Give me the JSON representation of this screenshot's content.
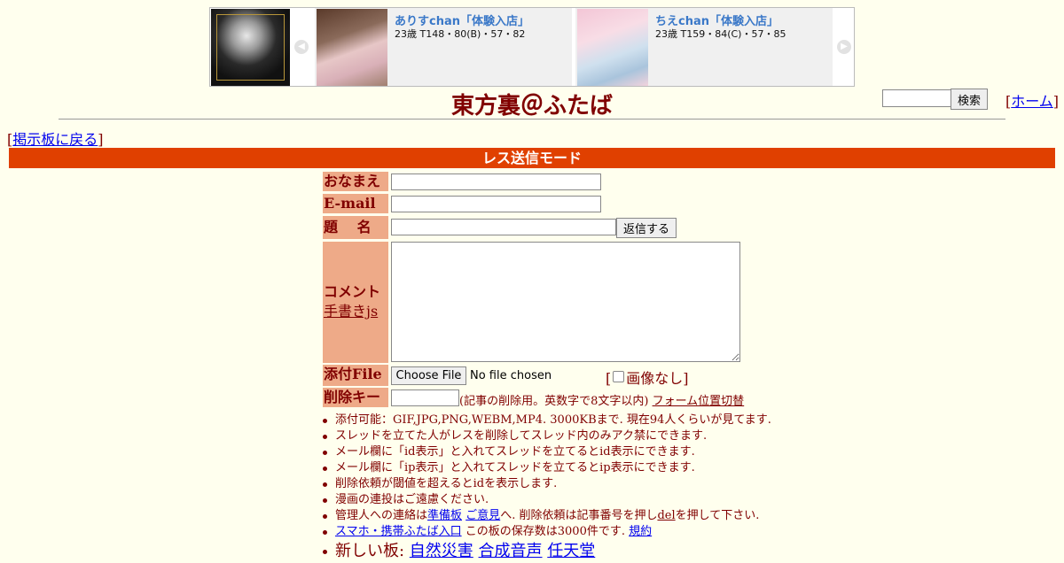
{
  "ad_banner": {
    "prev_arrow": "◀",
    "next_arrow": "▶",
    "cards": [
      {
        "name": "ありすchan「体験入店」",
        "detail": "23歳 T148・80(B)・57・82"
      },
      {
        "name": "ちえchan「体験入店」",
        "detail": "23歳 T159・84(C)・57・85"
      }
    ]
  },
  "header": {
    "site_title": "東方裏＠ふたば",
    "search_button": "検索",
    "search_value": "",
    "home_open": "[",
    "home_link": "ホーム",
    "home_close": "]"
  },
  "nav": {
    "back_open": "[",
    "back_link": "掲示板に戻る",
    "back_close": "]"
  },
  "mode_bar": {
    "label": "レス送信モード"
  },
  "form": {
    "name_label": "おなまえ",
    "email_label": "E-mail",
    "subject_label": "題　 名",
    "reply_button": "返信する",
    "comment_label": "コメント",
    "drawing_link": "手書きjs",
    "file_label": "添付File",
    "file_button": "Choose File",
    "file_status": "No file chosen",
    "no_image_open": "[",
    "no_image_label": "画像なし]",
    "delete_key_label": "削除キー",
    "delete_key_note": "(記事の削除用。英数字で8文字以内)",
    "form_position_link": "フォーム位置切替"
  },
  "notes": {
    "line1": "添付可能：GIF,JPG,PNG,WEBM,MP4. 3000KBまで. 現在94人くらいが見てます.",
    "line2": "スレッドを立てた人がレスを削除してスレッド内のみアク禁にできます.",
    "line3": "メール欄に「id表示」と入れてスレッドを立てるとid表示にできます.",
    "line4": "メール欄に「ip表示」と入れてスレッドを立てるとip表示にできます.",
    "line5": "削除依頼が閾値を超えるとidを表示します.",
    "line6": "漫画の連投はご遠慮ください.",
    "line7_prefix": "管理人への連絡は",
    "line7_link1": "準備板",
    "line7_link2": "ご意見",
    "line7_mid": "へ. 削除依頼は記事番号を押し",
    "line7_del": "del",
    "line7_suffix": "を押して下さい.",
    "line8_link": "スマホ・携帯ふたば入口",
    "line8_text": " この板の保存数は3000件です.",
    "line8_rules": "規約",
    "line9_prefix": "新しい板: ",
    "line9_link1": "自然災害",
    "line9_link2": "合成音声",
    "line9_link3": "任天堂"
  },
  "colors": {
    "background": "#ffffee",
    "text": "#800000",
    "mode_bar": "#e04000",
    "label_bg": "#eeaa88"
  }
}
